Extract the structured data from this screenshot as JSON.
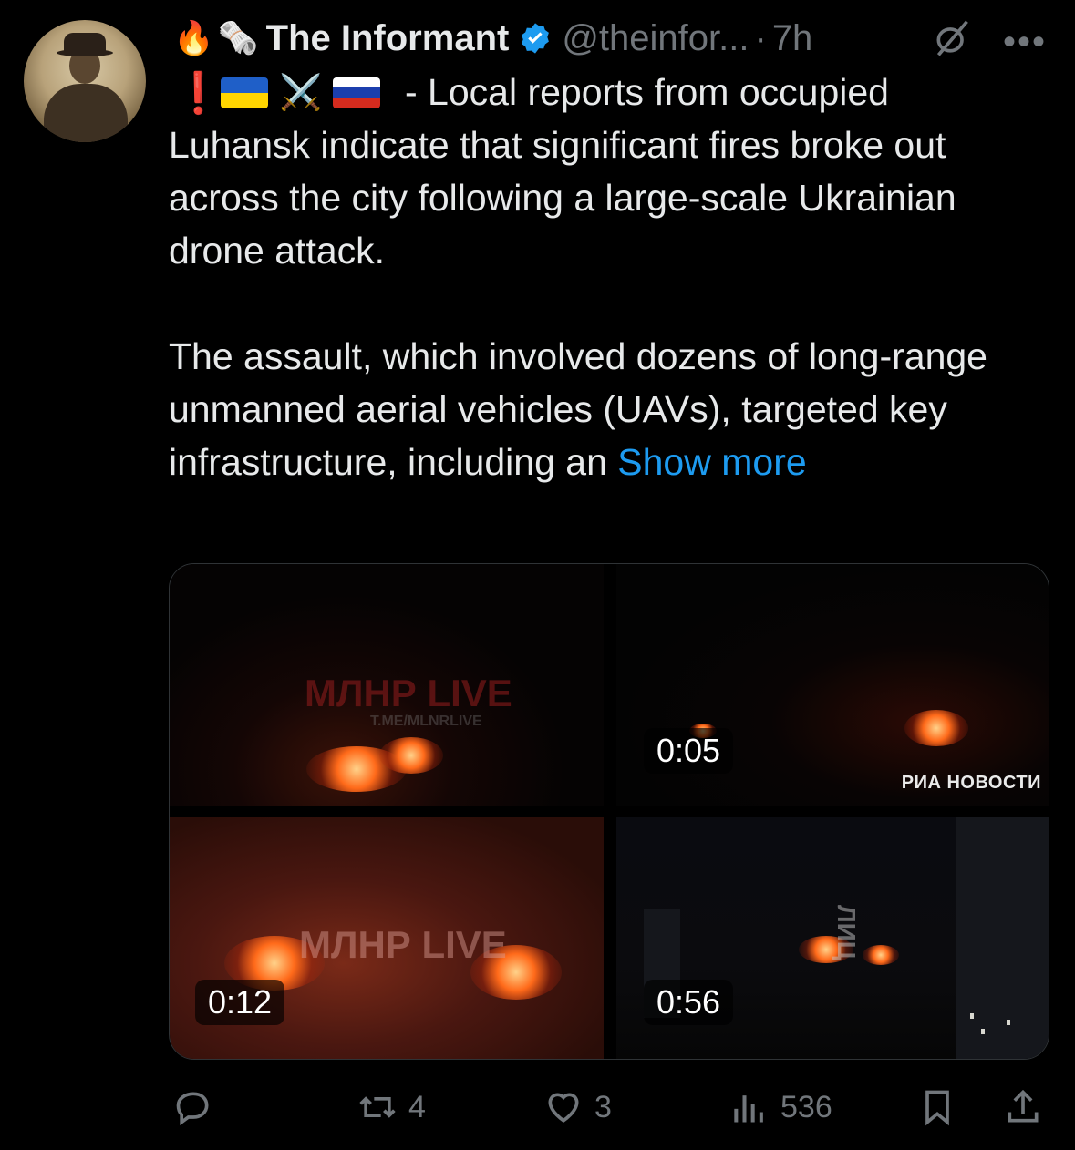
{
  "post": {
    "author_name": "The Informant",
    "handle": "@theinfor...",
    "separator": "·",
    "time": "7h",
    "more_label": "•••",
    "header_emojis": [
      "🔥",
      "🗞️"
    ],
    "flag_emojis": [
      "❗",
      "🇺🇦",
      "⚔️",
      "🇷🇺"
    ],
    "line1": "- Local reports from occupied",
    "paragraph1": "Luhansk indicate that significant fires broke out across the city following a large-scale Ukrainian drone attack.",
    "paragraph2": "The assault, which involved dozens of long-range unmanned aerial vehicles (UAVs), targeted key infrastructure, including an",
    "show_more": "Show more"
  },
  "media": {
    "tile1": {
      "watermark": "МЛНР LIVE",
      "watermark_small": "T.ME/MLNRLIVE"
    },
    "tile2": {
      "duration": "0:05",
      "watermark": "РИА НОВОСТИ"
    },
    "tile3": {
      "duration": "0:12",
      "watermark": "МЛНР LIVE"
    },
    "tile4": {
      "duration": "0:56",
      "watermark": "ЛИЦ"
    }
  },
  "actions": {
    "reply_count": "",
    "repost_count": "4",
    "like_count": "3",
    "views_count": "536"
  },
  "colors": {
    "background": "#000000",
    "text": "#e7e9ea",
    "muted": "#71767b",
    "link": "#1d9bf0",
    "verified": "#1d9bf0"
  }
}
